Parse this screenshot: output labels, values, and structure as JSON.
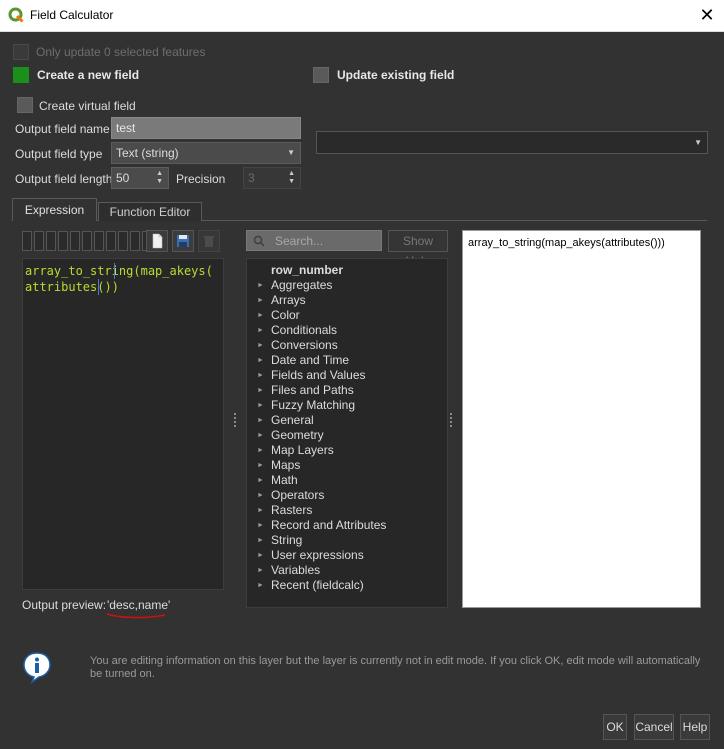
{
  "window": {
    "title": "Field Calculator",
    "close_glyph": "✕"
  },
  "options": {
    "only_update": "Only update 0 selected features",
    "create_new": "Create a new field",
    "update_existing": "Update existing field",
    "create_virtual": "Create virtual field"
  },
  "fields": {
    "output_name_label": "Output field name",
    "output_name_value": "test",
    "output_type_label": "Output field type",
    "output_type_value": "Text (string)",
    "output_length_label": "Output field length",
    "output_length_value": "50",
    "precision_label": "Precision",
    "precision_value": "3"
  },
  "tabs": {
    "expression": "Expression",
    "function_editor": "Function Editor"
  },
  "editor": {
    "line1": "array_to_string(map_akeys(",
    "line2": "attributes())"
  },
  "preview": {
    "label": "Output preview:",
    "value": "'desc,name'"
  },
  "search": {
    "placeholder": "Search...",
    "show_help": "Show Help"
  },
  "tree": {
    "items": [
      {
        "label": "row_number",
        "bold": true,
        "caret": false
      },
      {
        "label": "Aggregates",
        "caret": true
      },
      {
        "label": "Arrays",
        "caret": true
      },
      {
        "label": "Color",
        "caret": true
      },
      {
        "label": "Conditionals",
        "caret": true
      },
      {
        "label": "Conversions",
        "caret": true
      },
      {
        "label": "Date and Time",
        "caret": true
      },
      {
        "label": "Fields and Values",
        "caret": true
      },
      {
        "label": "Files and Paths",
        "caret": true
      },
      {
        "label": "Fuzzy Matching",
        "caret": true
      },
      {
        "label": "General",
        "caret": true
      },
      {
        "label": "Geometry",
        "caret": true
      },
      {
        "label": "Map Layers",
        "caret": true
      },
      {
        "label": "Maps",
        "caret": true
      },
      {
        "label": "Math",
        "caret": true
      },
      {
        "label": "Operators",
        "caret": true
      },
      {
        "label": "Rasters",
        "caret": true
      },
      {
        "label": "Record and Attributes",
        "caret": true
      },
      {
        "label": "String",
        "caret": true
      },
      {
        "label": "User expressions",
        "caret": true
      },
      {
        "label": "Variables",
        "caret": true
      },
      {
        "label": "Recent (fieldcalc)",
        "caret": true
      }
    ]
  },
  "help_panel": {
    "text": "array_to_string(map_akeys(attributes()))"
  },
  "message": {
    "text": "You are editing information on this layer but the layer is currently not in edit mode. If you click OK, edit mode will automatically be turned on.",
    "icon": "info-icon"
  },
  "buttons": {
    "ok": "OK",
    "cancel": "Cancel",
    "help": "Help"
  },
  "colors": {
    "accent_green": "#1a8f1a",
    "code_green": "#b6dd33",
    "background": "#323232",
    "annotation_red": "#d01010"
  }
}
